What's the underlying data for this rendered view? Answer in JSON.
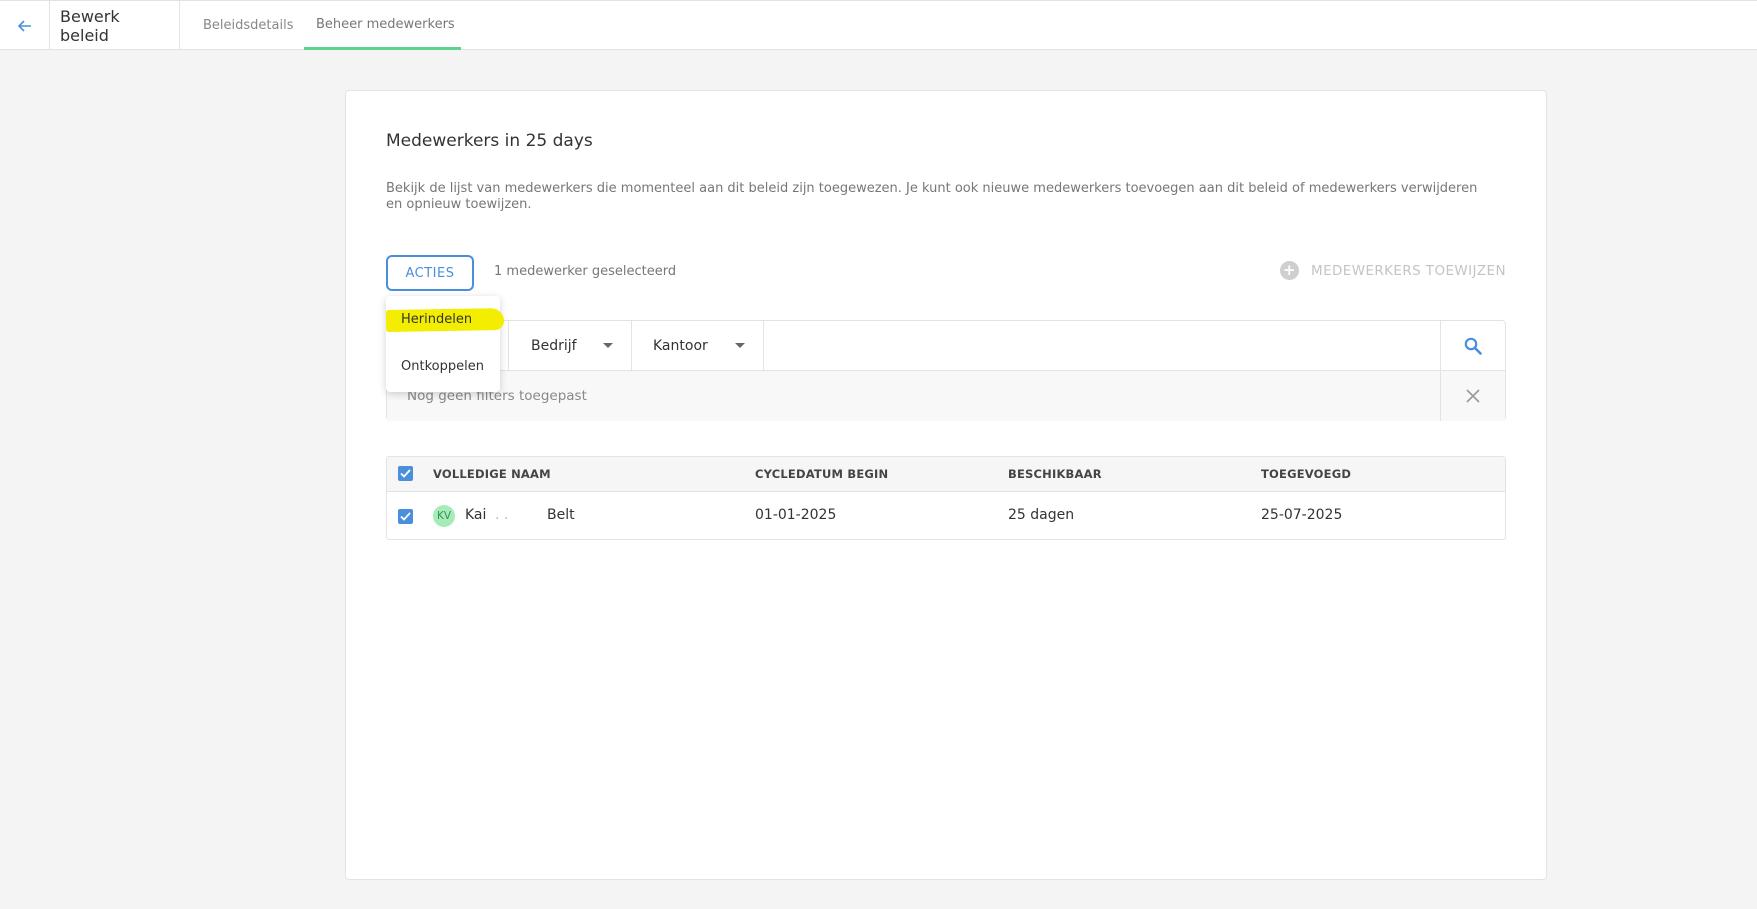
{
  "header": {
    "page_title": "Bewerk beleid",
    "tabs": [
      {
        "label": "Beleidsdetails"
      },
      {
        "label": "Beheer medewerkers"
      }
    ],
    "active_tab_color": "#5cd28a"
  },
  "card": {
    "title": "Medewerkers in 25 days",
    "description": "Bekijk de lijst van medewerkers die momenteel aan dit beleid zijn toegewezen. Je kunt ook nieuwe medewerkers toevoegen aan dit beleid of medewerkers verwijderen en opnieuw toewijzen."
  },
  "actions": {
    "acties_label": "ACTIES",
    "selected_text": "1 medewerker geselecteerd",
    "assign_label": "MEDEWERKERS TOEWIJZEN",
    "menu": [
      {
        "label": "Herindelen",
        "highlighted": true
      },
      {
        "label": "Ontkoppelen",
        "highlighted": false
      }
    ]
  },
  "filters": {
    "dropdowns": [
      {
        "label": ""
      },
      {
        "label": "Bedrijf"
      },
      {
        "label": "Kantoor"
      }
    ],
    "status_text": "Nog geen filters toegepast"
  },
  "table": {
    "columns": [
      "VOLLEDIGE NAAM",
      "CYCLEDATUM BEGIN",
      "BESCHIKBAAR",
      "TOEGEVOEGD"
    ],
    "rows": [
      {
        "initials": "KV",
        "first_name": "Kai",
        "obscured": ". .",
        "last_name": "Belt",
        "cycle_start": "01-01-2025",
        "available": "25 dagen",
        "added": "25-07-2025",
        "checked": true
      }
    ]
  },
  "colors": {
    "accent": "#4a8fdc",
    "highlight": "#f3ee00",
    "avatar_bg": "#a5ecb8"
  }
}
